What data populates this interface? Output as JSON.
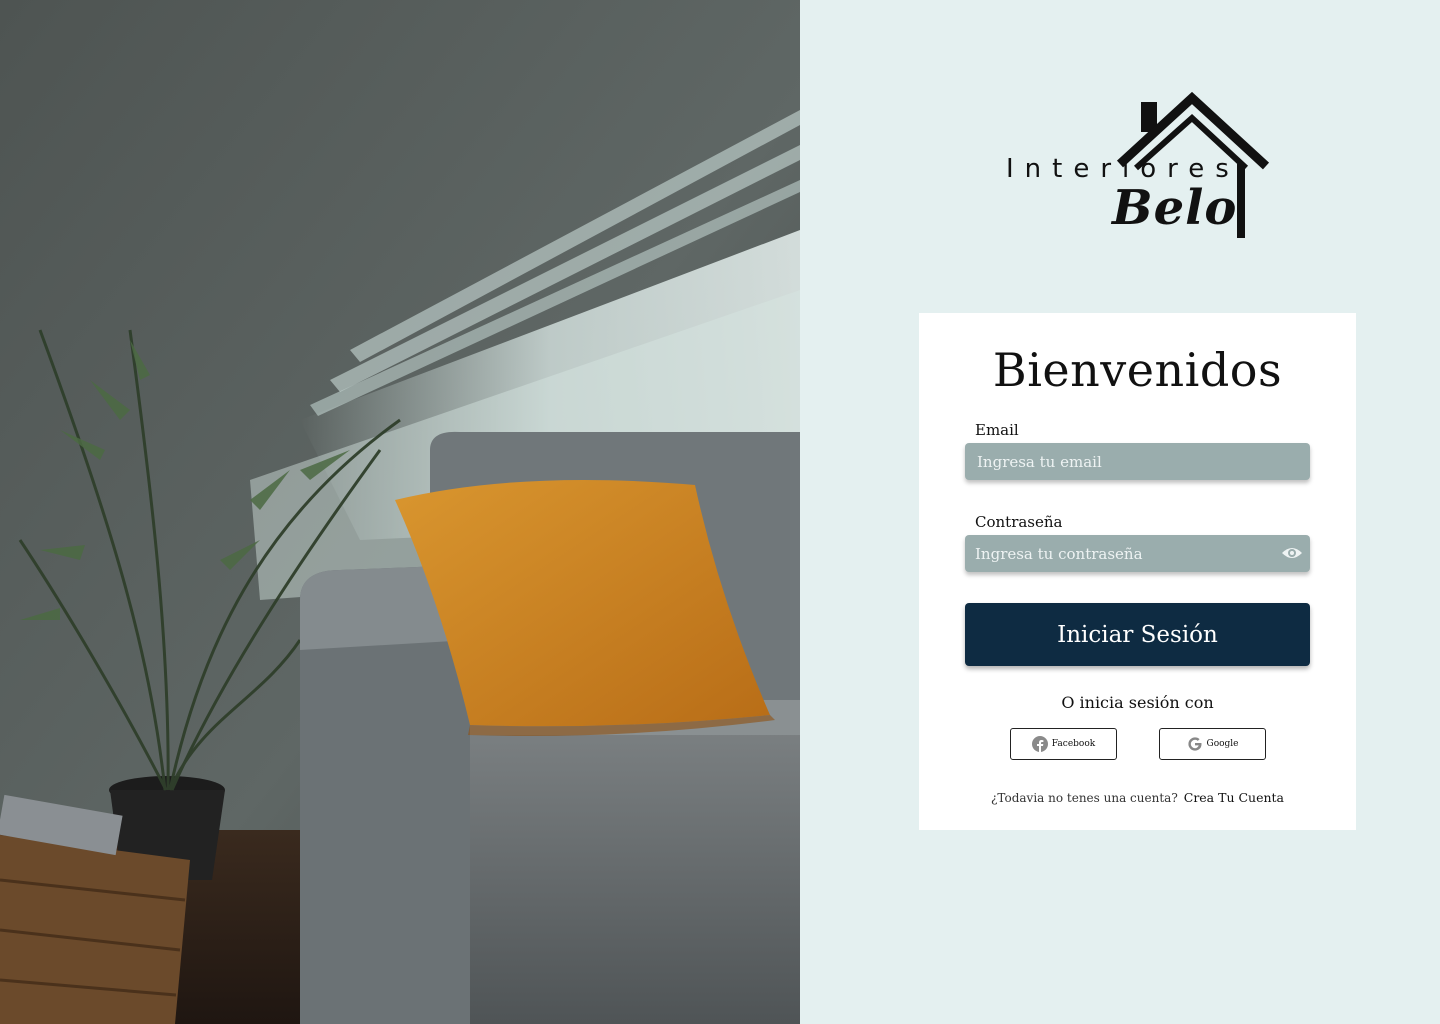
{
  "hero": {
    "image_description_icon": "living-room-photo"
  },
  "brand": {
    "word1": "Interiores",
    "word2": "Belo",
    "icon": "house-roof-icon"
  },
  "login": {
    "title": "Bienvenidos",
    "email_label": "Email",
    "email_placeholder": "Ingresa tu email",
    "email_value": "",
    "password_label": "Contraseña",
    "password_placeholder": "Ingresa tu contraseña",
    "password_value": "",
    "password_toggle_icon": "eye-icon",
    "submit_label": "Iniciar Sesión",
    "alt_prompt": "O inicia sesión con",
    "facebook_label": "Facebook",
    "google_label": "Google",
    "signup_prompt": "¿Todavia no tenes una cuenta?",
    "signup_link": "Crea Tu Cuenta"
  },
  "colors": {
    "page_bg": "#e4f0f0",
    "input_bg": "#9aadad",
    "button_bg": "#0e2b42",
    "card_bg": "#ffffff"
  }
}
